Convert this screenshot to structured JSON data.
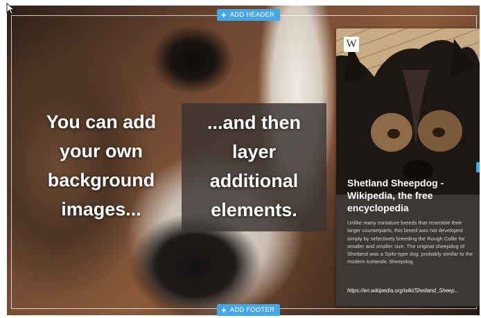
{
  "toolbar": {
    "add_header_label": "ADD HEADER",
    "add_footer_label": "ADD FOOTER"
  },
  "content": {
    "left_lines": [
      "You can add",
      "your own",
      "background",
      "images..."
    ],
    "box_lines": [
      "...and then",
      "layer",
      "additional",
      "elements."
    ]
  },
  "card": {
    "logo_letter": "W",
    "title": "Shetland Sheepdog - Wikipedia, the free encyclopedia",
    "description": "Unlike many miniature breeds that resemble their larger counterparts, this breed was not developed simply by selectively breeding the Rough Collie for smaller and smaller size. The original sheepdog of Shetland was a Spitz-type dog, probably similar to the modern Icelandic Sheepdog.",
    "url": "https://en.wikipedia.org/wiki/Shetland_Sheep..."
  },
  "colors": {
    "accent": "#45a7e6",
    "dark_overlay": "#3a3432",
    "card_bg": "#3d3836"
  },
  "icons": [
    "cursor-icon",
    "plus-icon",
    "wikipedia-logo-icon"
  ]
}
